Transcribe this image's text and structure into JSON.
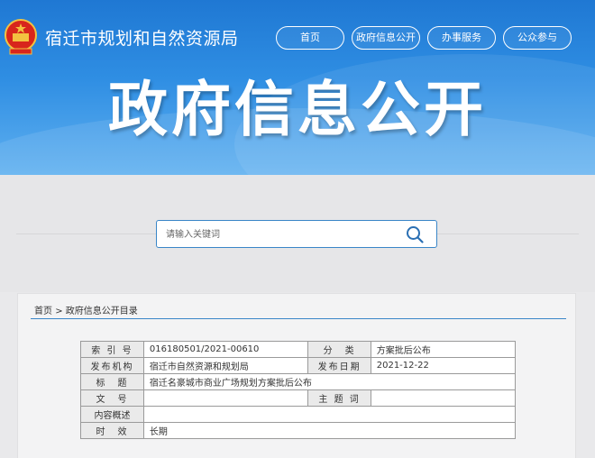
{
  "header": {
    "site_name": "宿迁市规划和自然资源局",
    "nav": [
      "首页",
      "政府信息公开",
      "办事服务",
      "公众参与"
    ],
    "hero_title": "政府信息公开"
  },
  "search": {
    "placeholder": "请输入关键词"
  },
  "breadcrumb": {
    "home": "首页",
    "separator": ">",
    "current": "政府信息公开目录"
  },
  "info_table": {
    "rows": [
      {
        "label": "索 引 号",
        "value": "016180501/2021-00610",
        "label2": "分　类",
        "value2": "方案批后公布"
      },
      {
        "label": "发布机构",
        "value": "宿迁市自然资源和规划局",
        "label2": "发布日期",
        "value2": "2021-12-22"
      },
      {
        "label": "标　题",
        "value": "宿迁名豪城市商业广场规划方案批后公布"
      },
      {
        "label": "文　号",
        "value": "",
        "label2": "主 题 词",
        "value2": ""
      },
      {
        "label": "内容概述",
        "value": ""
      },
      {
        "label": "时　效",
        "value": "长期"
      }
    ]
  },
  "colors": {
    "banner": "#2f8ee3",
    "accent": "#3a86c8"
  },
  "icons": [
    "national-emblem-icon",
    "search-icon"
  ]
}
